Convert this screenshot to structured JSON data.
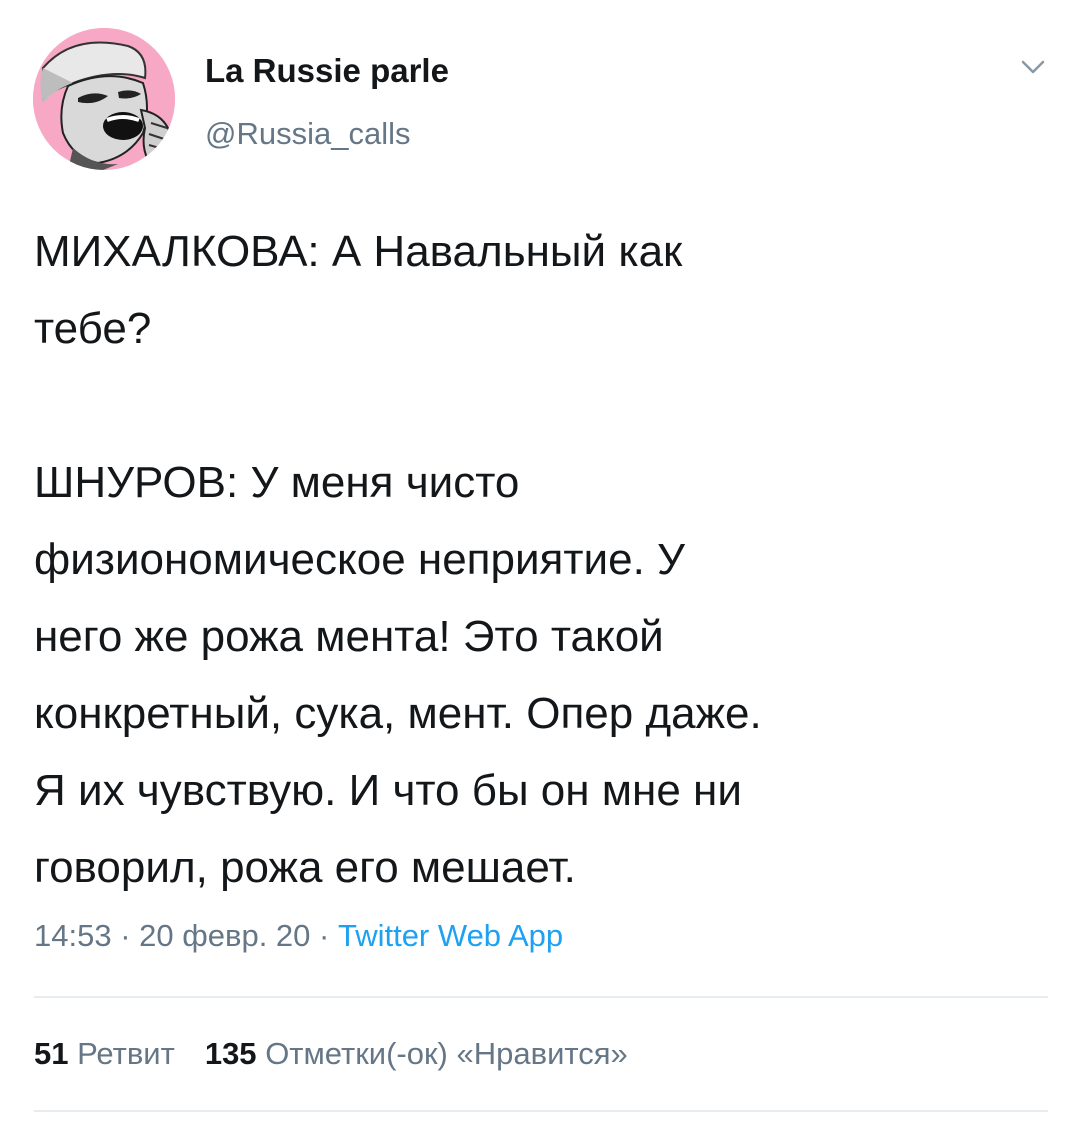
{
  "user": {
    "display_name": "La Russie parle",
    "handle": "@Russia_calls",
    "avatar_icon": "avatar-photo"
  },
  "tweet": {
    "paragraphs": [
      "МИХАЛКОВА: А Навальный как\nтебе?",
      "ШНУРОВ: У меня чисто\nфизиономическое неприятие. У\nнего же рожа мента! Это такой\nконкретный, сука, мент. Опер даже.\nЯ их чувствую. И что бы он мне ни\nговорил, рожа его мешает."
    ]
  },
  "meta": {
    "time": "14:53",
    "separator": " · ",
    "date": "20 февр. 20",
    "source": "Twitter Web App"
  },
  "stats": {
    "retweets_count": "51",
    "retweets_label": "Ретвит",
    "likes_count": "135",
    "likes_label": "Отметки(-ок) «Нравится»"
  },
  "colors": {
    "text": "#14171a",
    "secondary": "#657786",
    "link": "#1da1f2",
    "divider": "#e6ecf0",
    "avatar_bg": "#f7a8c4"
  },
  "icons": {
    "menu": "chevron-down-icon"
  }
}
